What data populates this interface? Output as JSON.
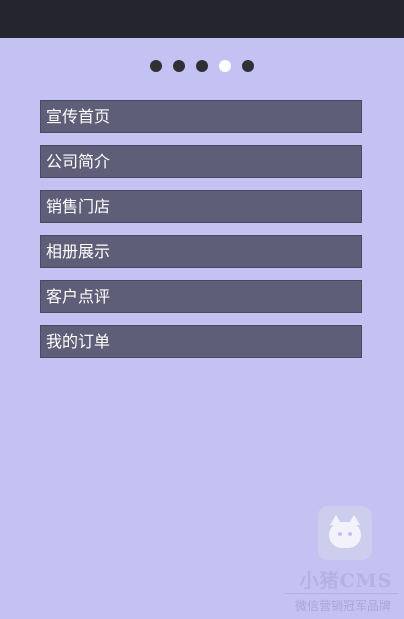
{
  "carousel": {
    "dots": 5,
    "active_index": 3
  },
  "menu": {
    "items": [
      {
        "label": "宣传首页"
      },
      {
        "label": "公司简介"
      },
      {
        "label": "销售门店"
      },
      {
        "label": "相册展示"
      },
      {
        "label": "客户点评"
      },
      {
        "label": "我的订单"
      }
    ]
  },
  "watermark": {
    "icon": "pig-face-icon",
    "title": "小猪CMS",
    "subtitle": "微信营销冠军品牌"
  },
  "colors": {
    "background": "#c3c2f3",
    "topbar": "#25252f",
    "menu_item": "#5f5e78",
    "dot": "#2f2f34",
    "dot_active": "#ffffff"
  }
}
